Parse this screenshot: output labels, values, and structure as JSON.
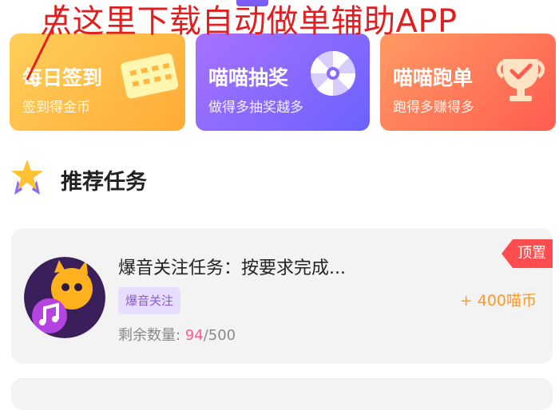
{
  "overlay": {
    "download_text": "点这里下载自动做单辅助APP"
  },
  "cards": [
    {
      "title": "每日签到",
      "subtitle": "签到得金币",
      "icon": "calendar-icon"
    },
    {
      "title": "喵喵抽奖",
      "subtitle": "做得多抽奖越多",
      "icon": "lottery-wheel-icon"
    },
    {
      "title": "喵喵跑单",
      "subtitle": "跑得多赚得多",
      "icon": "trophy-icon"
    }
  ],
  "section": {
    "title": "推荐任务",
    "icon": "star-icon"
  },
  "task": {
    "title": "爆音关注任务：按要求完成...",
    "tag": "爆音关注",
    "remaining_label": "剩余数量: ",
    "remaining_count": "94",
    "total_suffix": "/500",
    "reward": "+ 400喵币",
    "pin_label": "顶置"
  },
  "colors": {
    "overlay_red": "#e02020",
    "checkin_card": "#ffb73f",
    "lottery_card": "#8a69ff",
    "run_card": "#ff7259",
    "reward": "#ff9a2a",
    "pin": "#ff4d4f",
    "tag_bg": "#e8dcff"
  }
}
